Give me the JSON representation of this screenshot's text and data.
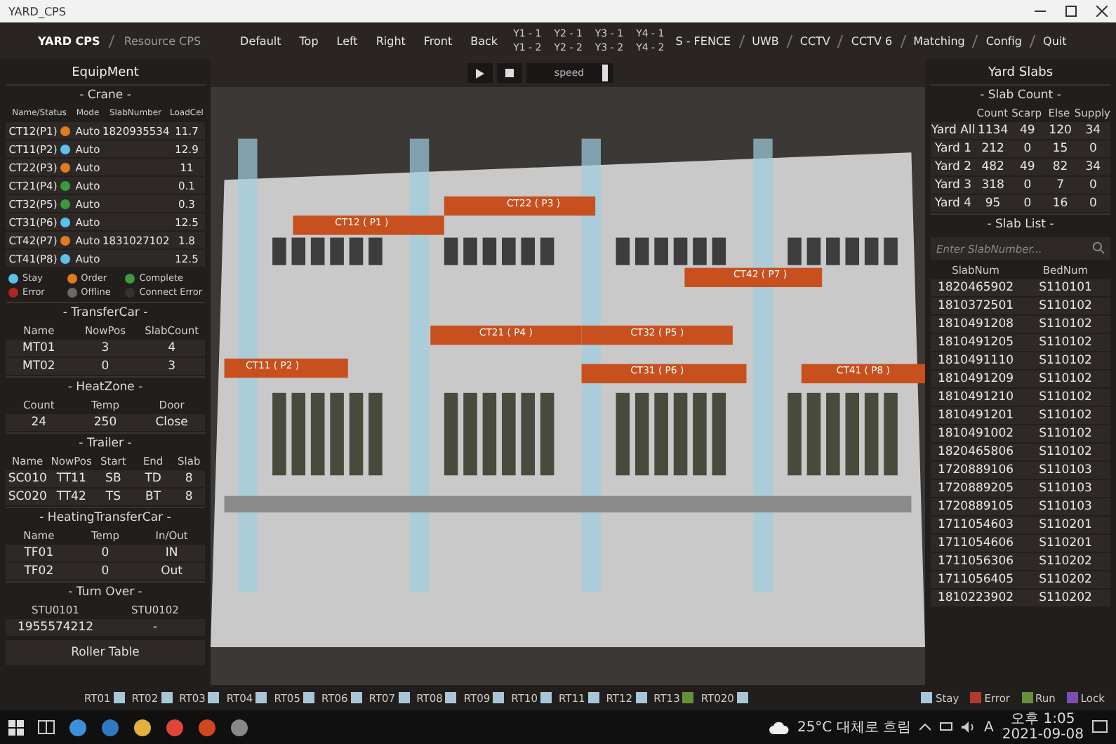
{
  "window": {
    "title": "YARD_CPS"
  },
  "nav": {
    "breadcrumbs": [
      {
        "label": "YARD CPS",
        "selected": true
      },
      {
        "label": "Resource CPS",
        "selected": false
      }
    ],
    "views": [
      "Default",
      "Top",
      "Left",
      "Right",
      "Front",
      "Back"
    ],
    "yards": [
      {
        "top": "Y1 - 1",
        "bottom": "Y1 - 2"
      },
      {
        "top": "Y2 - 1",
        "bottom": "Y2 - 2"
      },
      {
        "top": "Y3 - 1",
        "bottom": "Y3 - 2"
      },
      {
        "top": "Y4 - 1",
        "bottom": "Y4 - 2"
      }
    ],
    "menu": [
      "S - FENCE",
      "UWB",
      "CCTV",
      "CCTV 6",
      "Matching",
      "Config",
      "Quit"
    ]
  },
  "playback": {
    "speed_label": "speed",
    "level": 0.95
  },
  "equipment": {
    "title": "EquipMent",
    "crane": {
      "title": "- Crane -",
      "columns": [
        "Name/Status",
        "Mode",
        "SlabNumber",
        "LoadCel"
      ],
      "rows": [
        {
          "name": "CT12(P1)",
          "color": "#e07b22",
          "mode": "Auto",
          "slab": "1820935534",
          "load": "11.7"
        },
        {
          "name": "CT11(P2)",
          "color": "#5bc0eb",
          "mode": "Auto",
          "load": "12.9"
        },
        {
          "name": "CT22(P3)",
          "color": "#e07b22",
          "mode": "Auto",
          "load": "11"
        },
        {
          "name": "CT21(P4)",
          "color": "#3c9a3c",
          "mode": "Auto",
          "load": "0.1"
        },
        {
          "name": "CT32(P5)",
          "color": "#3c9a3c",
          "mode": "Auto",
          "load": "0.3"
        },
        {
          "name": "CT31(P6)",
          "color": "#5bc0eb",
          "mode": "Auto",
          "load": "12.5"
        },
        {
          "name": "CT42(P7)",
          "color": "#e07b22",
          "mode": "Auto",
          "slab": "1831027102",
          "load": "1.8"
        },
        {
          "name": "CT41(P8)",
          "color": "#5bc0eb",
          "mode": "Auto",
          "load": "12.5"
        }
      ],
      "legend": [
        {
          "label": "Stay",
          "color": "#5bc0eb"
        },
        {
          "label": "Order",
          "color": "#e07b22"
        },
        {
          "label": "Complete",
          "color": "#3c9a3c"
        },
        {
          "label": "Error",
          "color": "#b02424"
        },
        {
          "label": "Offline",
          "color": "#6a6a6a"
        },
        {
          "label": "Connect Error",
          "color": "#333333"
        }
      ]
    },
    "sections": [
      {
        "title": "- TransferCar -",
        "columns": [
          "Name",
          "NowPos",
          "SlabCount"
        ],
        "rows": [
          [
            "MT01",
            "3",
            "4"
          ],
          [
            "MT02",
            "0",
            "3"
          ]
        ]
      },
      {
        "title": "- HeatZone -",
        "columns": [
          "Count",
          "Temp",
          "Door"
        ],
        "rows": [
          [
            "24",
            "250",
            "Close"
          ]
        ]
      },
      {
        "title": "- Trailer -",
        "columns": [
          "Name",
          "NowPos",
          "Start",
          "End",
          "Slab"
        ],
        "rows": [
          [
            "SC010",
            "TT11",
            "SB",
            "TD",
            "8"
          ],
          [
            "SC020",
            "TT42",
            "TS",
            "BT",
            "8"
          ]
        ]
      },
      {
        "title": "- HeatingTransferCar -",
        "columns": [
          "Name",
          "Temp",
          "In/Out"
        ],
        "rows": [
          [
            "TF01",
            "0",
            "IN"
          ],
          [
            "TF02",
            "0",
            "Out"
          ]
        ]
      },
      {
        "title": "- Turn Over -",
        "columns": [
          "STU0101",
          "STU0102"
        ],
        "rows": [
          [
            "1955574212",
            "-"
          ]
        ]
      }
    ],
    "roller_table": "Roller Table"
  },
  "yard_view": {
    "crane_labels": [
      "CT12 ( P1 )",
      "CT22 ( P3 )",
      "CT42 ( P7 )",
      "CT21 ( P4 )",
      "CT32 ( P5 )",
      "CT11 ( P2 )",
      "CT31 ( P6 )",
      "CT41 ( P8 )"
    ]
  },
  "yard_slabs": {
    "title": "Yard Slabs",
    "slab_count": {
      "title": "- Slab Count -",
      "columns": [
        "Count",
        "Scarp",
        "Else",
        "Supply"
      ],
      "rows": [
        {
          "label": "Yard All",
          "values": [
            "1134",
            "49",
            "120",
            "34"
          ]
        },
        {
          "label": "Yard 1",
          "values": [
            "212",
            "0",
            "15",
            "0"
          ]
        },
        {
          "label": "Yard 2",
          "values": [
            "482",
            "49",
            "82",
            "34"
          ]
        },
        {
          "label": "Yard 3",
          "values": [
            "318",
            "0",
            "7",
            "0"
          ]
        },
        {
          "label": "Yard 4",
          "values": [
            "95",
            "0",
            "16",
            "0"
          ]
        }
      ]
    },
    "slab_list": {
      "title": "- Slab List -",
      "search": {
        "placeholder": "Enter SlabNumber..."
      },
      "columns": [
        "SlabNum",
        "BedNum"
      ],
      "rows": [
        [
          "1820465902",
          "S110101"
        ],
        [
          "1810372501",
          "S110102"
        ],
        [
          "1810491208",
          "S110102"
        ],
        [
          "1810491205",
          "S110102"
        ],
        [
          "1810491110",
          "S110102"
        ],
        [
          "1810491209",
          "S110102"
        ],
        [
          "1810491210",
          "S110102"
        ],
        [
          "1810491201",
          "S110102"
        ],
        [
          "1810491002",
          "S110102"
        ],
        [
          "1820465806",
          "S110102"
        ],
        [
          "1720889106",
          "S110103"
        ],
        [
          "1720889205",
          "S110103"
        ],
        [
          "1720889105",
          "S110103"
        ],
        [
          "1711054603",
          "S110201"
        ],
        [
          "1711054606",
          "S110201"
        ],
        [
          "1711056306",
          "S110202"
        ],
        [
          "1711056405",
          "S110202"
        ],
        [
          "1810223902",
          "S110202"
        ]
      ]
    }
  },
  "roller_tables": {
    "items": [
      {
        "label": "RT01",
        "color": "#a9c6d8"
      },
      {
        "label": "RT02",
        "color": "#a9c6d8"
      },
      {
        "label": "RT03",
        "color": "#a9c6d8"
      },
      {
        "label": "RT04",
        "color": "#a9c6d8"
      },
      {
        "label": "RT05",
        "color": "#a9c6d8"
      },
      {
        "label": "RT06",
        "color": "#a9c6d8"
      },
      {
        "label": "RT07",
        "color": "#a9c6d8"
      },
      {
        "label": "RT08",
        "color": "#a9c6d8"
      },
      {
        "label": "RT09",
        "color": "#a9c6d8"
      },
      {
        "label": "RT10",
        "color": "#a9c6d8"
      },
      {
        "label": "RT11",
        "color": "#a9c6d8"
      },
      {
        "label": "RT12",
        "color": "#a9c6d8"
      },
      {
        "label": "RT13",
        "color": "#6b8e3a"
      },
      {
        "label": "RT020",
        "color": "#a9c6d8"
      }
    ],
    "legend": [
      {
        "label": "Stay",
        "color": "#a9c6d8"
      },
      {
        "label": "Error",
        "color": "#b03a2e"
      },
      {
        "label": "Run",
        "color": "#6b8e3a"
      },
      {
        "label": "Lock",
        "color": "#7a4fb0"
      }
    ]
  },
  "taskbar": {
    "weather": "25°C 대체로 흐림",
    "ime": "A",
    "time": "오후 1:05",
    "date": "2021-09-08"
  }
}
